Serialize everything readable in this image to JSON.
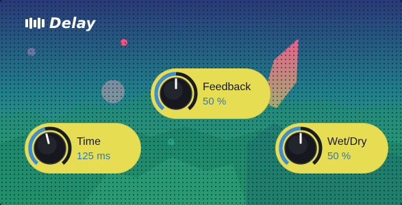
{
  "plugin": {
    "title": "Delay",
    "logo_icon": "presonus-logo-icon"
  },
  "controls": {
    "feedback": {
      "label": "Feedback",
      "value": "50 %",
      "level": 0.5
    },
    "time": {
      "label": "Time",
      "value": "125 ms",
      "level": 0.45
    },
    "wetdry": {
      "label": "Wet/Dry",
      "value": "50 %",
      "level": 0.5
    }
  },
  "colors": {
    "pill": "#e6dd52",
    "value_text": "#2a7bc5",
    "knob_arc": "#3b8fd9",
    "knob_body": "#16181d"
  }
}
